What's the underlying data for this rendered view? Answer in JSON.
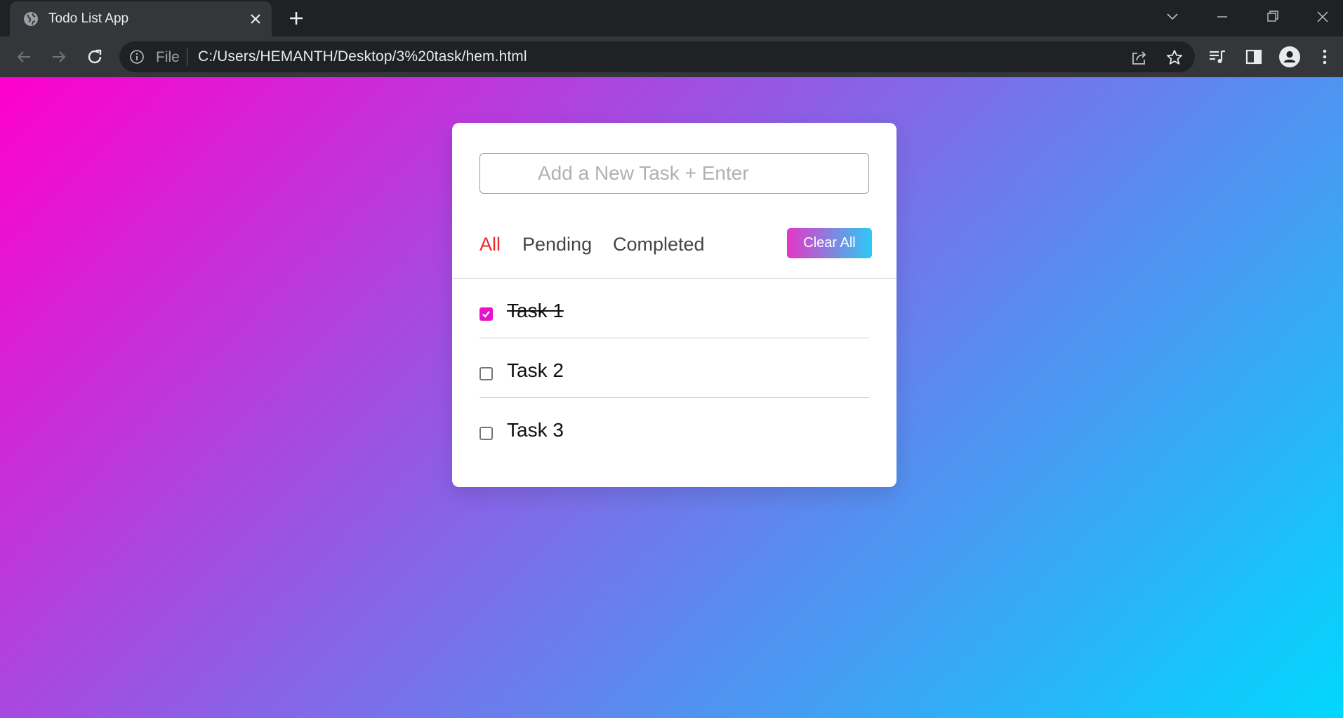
{
  "browser": {
    "tab_title": "Todo List App",
    "omnibox": {
      "scheme_label": "File",
      "url": "C:/Users/HEMANTH/Desktop/3%20task/hem.html"
    }
  },
  "app": {
    "input_placeholder": "Add a New Task + Enter",
    "filters": [
      {
        "label": "All",
        "active": true
      },
      {
        "label": "Pending",
        "active": false
      },
      {
        "label": "Completed",
        "active": false
      }
    ],
    "clear_label": "Clear All",
    "tasks": [
      {
        "label": "Task 1",
        "completed": true
      },
      {
        "label": "Task 2",
        "completed": false
      },
      {
        "label": "Task 3",
        "completed": false
      }
    ],
    "colors": {
      "gradient_start": "#ff00cc",
      "gradient_end": "#00d8ff",
      "active_filter": "#ea2a2a",
      "checkbox_checked": "#e614c8"
    }
  }
}
